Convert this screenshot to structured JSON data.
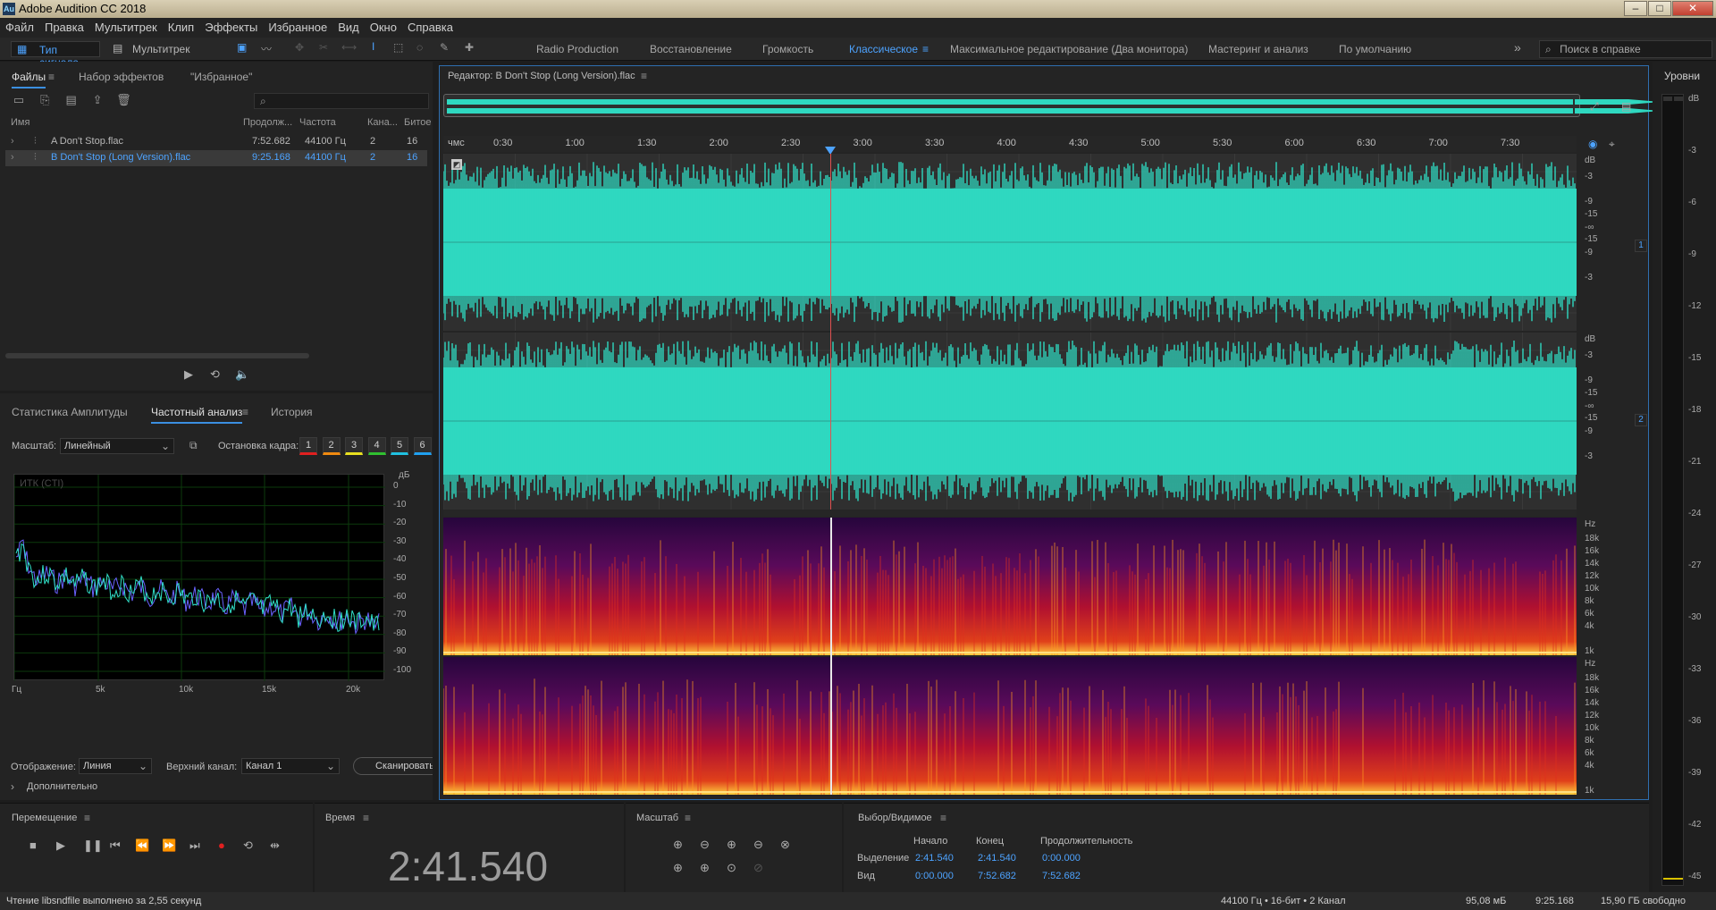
{
  "window": {
    "app_title": "Adobe Audition CC 2018",
    "app_icon": "Au"
  },
  "menu": [
    "Файл",
    "Правка",
    "Мультитрек",
    "Клип",
    "Эффекты",
    "Избранное",
    "Вид",
    "Окно",
    "Справка"
  ],
  "toolbar": {
    "waveform_label": "Тип сигнала",
    "multitrack_label": "Мультитрек",
    "workspaces": [
      "Radio Production",
      "Восстановление",
      "Громкость",
      "Классическое",
      "Максимальное редактирование (Два монитора)",
      "Мастеринг и анализ",
      "По умолчанию"
    ],
    "active_workspace": "Классическое",
    "overflow": "»",
    "help_placeholder": "Поиск в справке"
  },
  "files_panel": {
    "tabs": [
      "Файлы",
      "Набор эффектов",
      "\"Избранное\""
    ],
    "columns": [
      "Имя",
      "Продолж...",
      "Частота",
      "Кана...",
      "Битое"
    ],
    "rows": [
      {
        "name": "A Don't Stop.flac",
        "duration": "7:52.682",
        "rate": "44100 Гц",
        "channels": "2",
        "bits": "16"
      },
      {
        "name": "B Don't Stop (Long Version).flac",
        "duration": "9:25.168",
        "rate": "44100 Гц",
        "channels": "2",
        "bits": "16"
      }
    ]
  },
  "freq_panel": {
    "tabs": [
      "Статистика Амплитуды",
      "Частотный анализ",
      "История"
    ],
    "scale_label": "Масштаб:",
    "scale_value": "Линейный",
    "freeze_label": "Остановка кадра:",
    "freeze_buttons": [
      "1",
      "2",
      "3",
      "4",
      "5",
      "6"
    ],
    "freeze_colors": [
      "#e02020",
      "#f08a10",
      "#e8e020",
      "#30c030",
      "#20c0e0",
      "#20a0f0"
    ],
    "chart_title": "ИТК (CTI)",
    "db_unit": "дБ",
    "db_ticks": [
      "0",
      "-10",
      "-20",
      "-30",
      "-40",
      "-50",
      "-60",
      "-70",
      "-80",
      "-90",
      "-100"
    ],
    "freq_ticks": [
      "Гц",
      "5k",
      "10k",
      "15k",
      "20k"
    ],
    "display_label": "Отображение:",
    "display_value": "Линия",
    "channel_label": "Верхний канал:",
    "channel_value": "Канал 1",
    "scan_button": "Сканировать",
    "advanced": "Дополнительно"
  },
  "editor": {
    "title": "Редактор: B Don't Stop (Long Version).flac",
    "ruler_unit": "чмс",
    "ruler_ticks": [
      "0:30",
      "1:00",
      "1:30",
      "2:00",
      "2:30",
      "3:00",
      "3:30",
      "4:00",
      "4:30",
      "5:00",
      "5:30",
      "6:00",
      "6:30",
      "7:00",
      "7:30"
    ],
    "db_scale": [
      "dB",
      "-3",
      "-9",
      "-15",
      "-∞",
      "-15",
      "-9",
      "-3"
    ],
    "channels": [
      "1",
      "2"
    ],
    "hz_scale": [
      "Hz",
      "18k",
      "16k",
      "14k",
      "12k",
      "10k",
      "8k",
      "6k",
      "4k",
      "1k"
    ],
    "waveform_color": "#2fd8c0"
  },
  "levels": {
    "title": "Уровни",
    "ticks": [
      "dB",
      "-3",
      "-6",
      "-9",
      "-12",
      "-15",
      "-18",
      "-21",
      "-24",
      "-27",
      "-30",
      "-33",
      "-36",
      "-39",
      "-42",
      "-45"
    ]
  },
  "transport": {
    "title": "Перемещение"
  },
  "time": {
    "title": "Время",
    "value": "2:41.540"
  },
  "zoom": {
    "title": "Масштаб"
  },
  "selection": {
    "title": "Выбор/Видимое",
    "headers": [
      "Начало",
      "Конец",
      "Продолжительность"
    ],
    "rows": [
      {
        "label": "Выделение",
        "start": "2:41.540",
        "end": "2:41.540",
        "dur": "0:00.000"
      },
      {
        "label": "Вид",
        "start": "0:00.000",
        "end": "7:52.682",
        "dur": "7:52.682"
      }
    ]
  },
  "status": {
    "message": "Чтение libsndfile выполнено за 2,55 секунд",
    "format": "44100 Гц • 16-бит • 2 Канал",
    "size": "95,08 мБ",
    "duration": "9:25.168",
    "free": "15,90 ГБ свободно"
  }
}
